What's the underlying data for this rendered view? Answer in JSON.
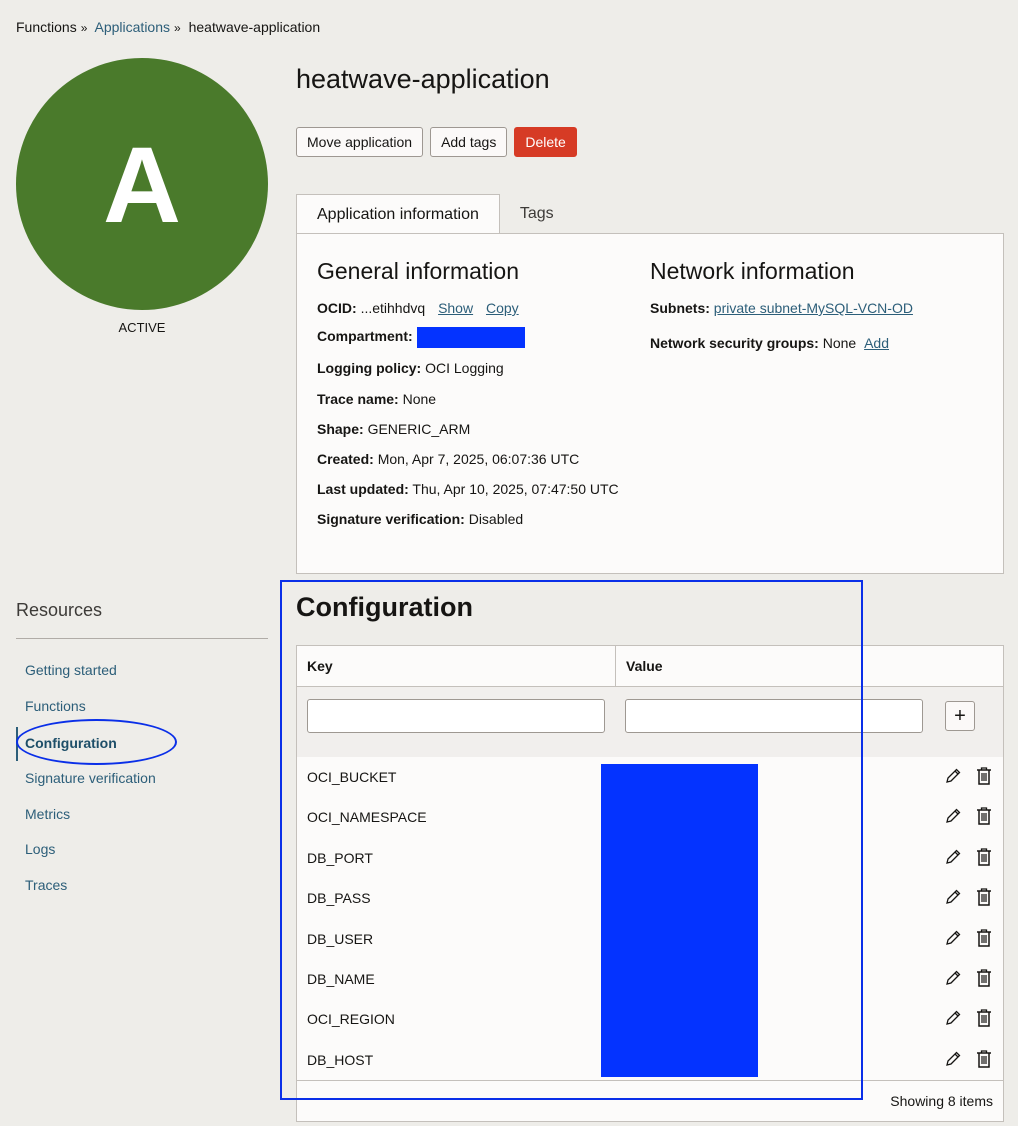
{
  "breadcrumb": {
    "root": "Functions",
    "parent": "Applications",
    "current": "heatwave-application",
    "separator": "»"
  },
  "avatar": {
    "letter": "A",
    "color": "#4a7a2b",
    "status": "ACTIVE"
  },
  "title": "heatwave-application",
  "actions": {
    "move": "Move application",
    "tags": "Add tags",
    "delete": "Delete"
  },
  "tabs": [
    "Application information",
    "Tags"
  ],
  "general": {
    "heading": "General information",
    "ocid_label": "OCID:",
    "ocid_value": "...etihhdvq",
    "show": "Show",
    "copy": "Copy",
    "compartment_label": "Compartment:",
    "logging_label": "Logging policy:",
    "logging_value": "OCI Logging",
    "trace_label": "Trace name:",
    "trace_value": "None",
    "shape_label": "Shape:",
    "shape_value": "GENERIC_ARM",
    "created_label": "Created:",
    "created_value": "Mon, Apr 7, 2025, 06:07:36 UTC",
    "updated_label": "Last updated:",
    "updated_value": "Thu, Apr 10, 2025, 07:47:50 UTC",
    "sig_label": "Signature verification:",
    "sig_value": "Disabled"
  },
  "network": {
    "heading": "Network information",
    "subnets_label": "Subnets:",
    "subnets_value": "private subnet-MySQL-VCN-OD",
    "nsg_label": "Network security groups:",
    "nsg_value": "None",
    "nsg_add": "Add"
  },
  "resources": {
    "title": "Resources",
    "items": [
      "Getting started",
      "Functions",
      "Configuration",
      "Signature verification",
      "Metrics",
      "Logs",
      "Traces"
    ],
    "active": "Configuration"
  },
  "config": {
    "heading": "Configuration",
    "col_key": "Key",
    "col_value": "Value",
    "plus": "+",
    "rows": [
      "OCI_BUCKET",
      "OCI_NAMESPACE",
      "DB_PORT",
      "DB_PASS",
      "DB_USER",
      "DB_NAME",
      "OCI_REGION",
      "DB_HOST"
    ],
    "footer": "Showing 8 items"
  },
  "colors": {
    "accent": "#2c5e79",
    "danger": "#d63b25",
    "redaction": "#0433ff",
    "annotation": "#0a2fe8"
  }
}
